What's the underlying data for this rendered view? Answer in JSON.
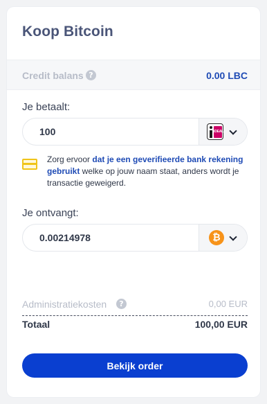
{
  "header": {
    "title": "Koop Bitcoin"
  },
  "balance": {
    "label": "Credit balans",
    "value": "0.00 LBC",
    "help_icon": "question-circle-icon"
  },
  "pay": {
    "label": "Je betaalt:",
    "amount": "100",
    "method_icon": "ideal-icon",
    "method_icon_text": "iDEAL"
  },
  "notice": {
    "icon": "credit-card-icon",
    "text_before": "Zorg ervoor ",
    "link": "dat je een geverifieerde bank rekening gebruikt",
    "text_after": " welke op jouw naam staat, anders wordt je transactie geweigerd."
  },
  "receive": {
    "label": "Je ontvangt:",
    "amount": "0.00214978",
    "currency_icon": "bitcoin-icon",
    "currency_symbol": "₿"
  },
  "fees": {
    "label": "Administratiekosten",
    "value": "0,00 EUR"
  },
  "total": {
    "label": "Totaal",
    "value": "100,00 EUR"
  },
  "actions": {
    "order_label": "Bekijk order"
  },
  "colors": {
    "accent": "#0a3fd0",
    "link": "#1f4bb5",
    "bitcoin": "#f7931a",
    "ideal": "#cc0066",
    "notice": "#f0c419"
  }
}
